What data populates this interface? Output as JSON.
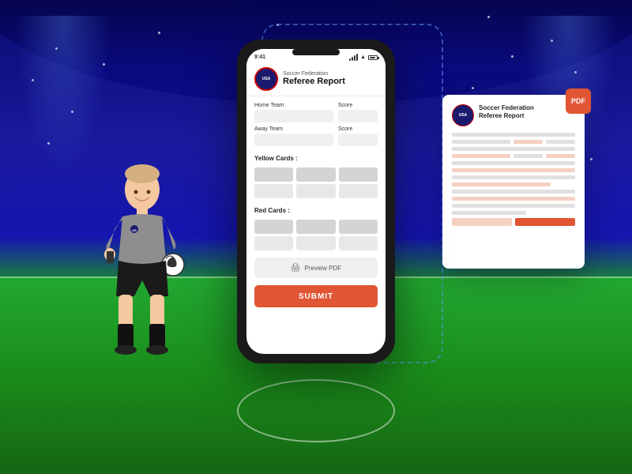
{
  "background": {
    "topColor": "#0a0a6e",
    "fieldColor": "#22a832"
  },
  "phone": {
    "statusBar": {
      "time": "9:41",
      "signal": "●●●",
      "wifi": "wifi",
      "battery": "100%"
    },
    "header": {
      "logoText": "USA",
      "subtitle": "Soccer Federation",
      "title": "Referee Report"
    },
    "form": {
      "homeTeamLabel": "Home Team",
      "homeScoreLabel": "Score",
      "awayTeamLabel": "Away Team",
      "awayScoreLabel": "Score",
      "yellowCardsLabel": "Yellow Cards :",
      "redCardsLabel": "Red Cards :",
      "previewButton": "Preview PDF",
      "submitButton": "SUBMIT"
    }
  },
  "pdfCard": {
    "badgeText": "PDF",
    "title": "Soccer Federation\nReferee Report",
    "logoText": "USA"
  },
  "icons": {
    "printIcon": "🖨",
    "shieldIcon": "🛡"
  }
}
